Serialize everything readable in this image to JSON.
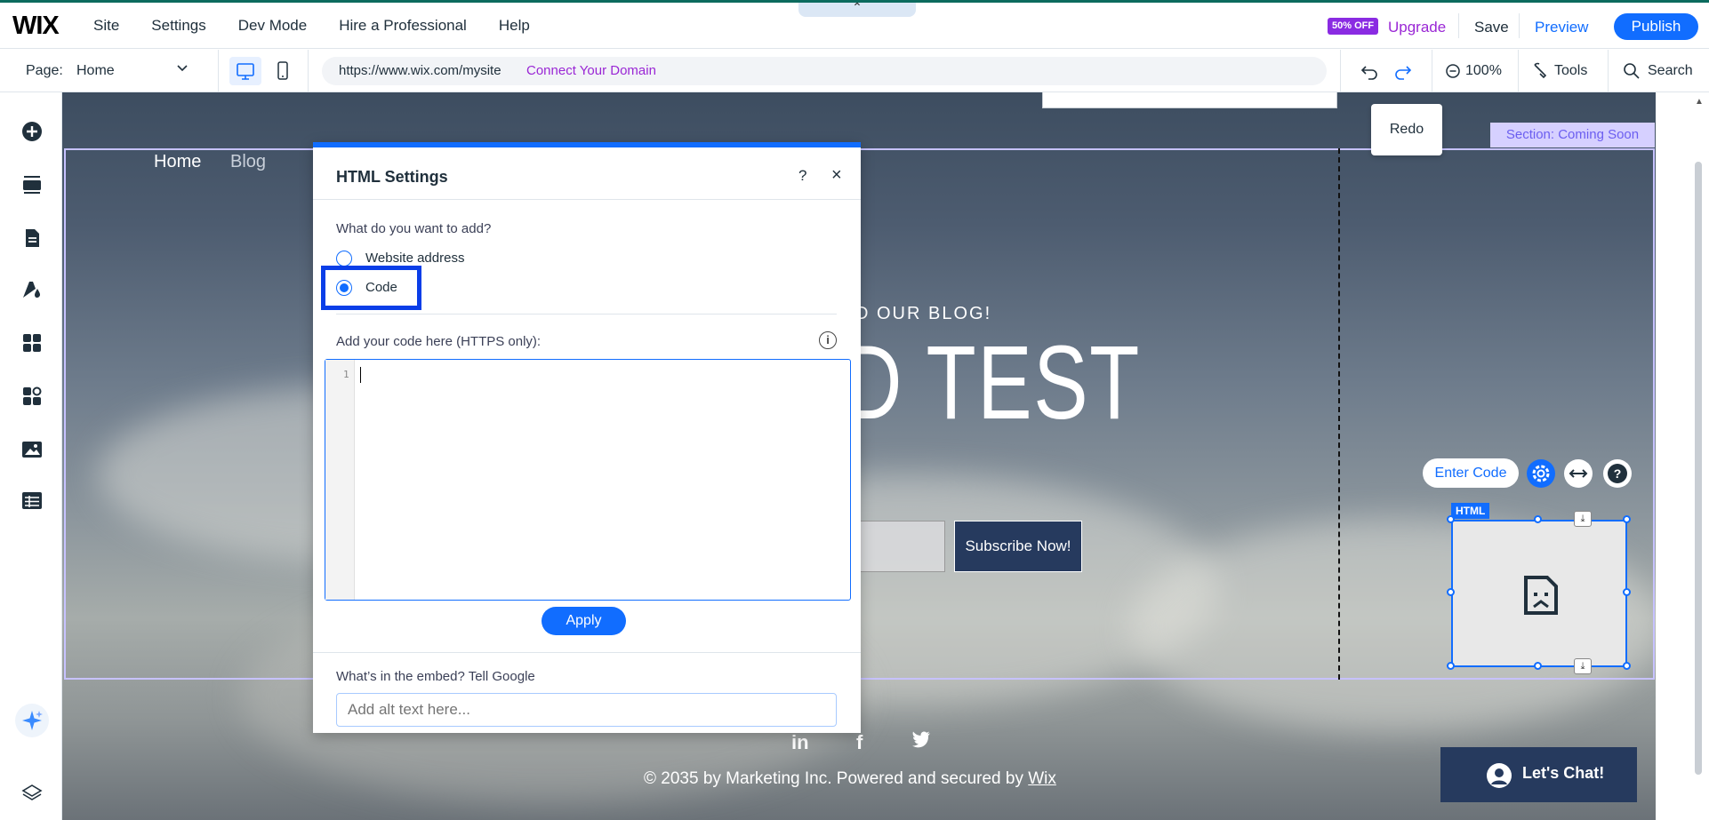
{
  "topbar": {
    "logo": "WIX",
    "menu": [
      "Site",
      "Settings",
      "Dev Mode",
      "Hire a Professional",
      "Help"
    ],
    "handle_icon": "chevron-up-icon",
    "discount_badge": "50% OFF",
    "upgrade": "Upgrade",
    "save": "Save",
    "preview": "Preview",
    "publish": "Publish"
  },
  "toolbar": {
    "page_label": "Page:",
    "page_value": "Home",
    "url": "https://www.wix.com/mysite",
    "connect_domain": "Connect Your Domain",
    "zoom": "100%",
    "tools": "Tools",
    "search": "Search",
    "redo_tooltip": "Redo"
  },
  "canvas": {
    "section_badge": "Section: Coming Soon",
    "nav": [
      "Home",
      "Blog"
    ],
    "blog_heading": "D OUR BLOG!",
    "big_heading": "D TEST",
    "subscribe": "Subscribe Now!",
    "copyright_prefix": "© 2035 by Marketing Inc. Powered and secured by ",
    "copyright_link": "Wix",
    "chat": "Let's Chat!",
    "social": [
      "in",
      "f",
      "t"
    ]
  },
  "html_element": {
    "enter_code": "Enter Code",
    "tag": "HTML",
    "help": "?"
  },
  "dialog": {
    "title": "HTML Settings",
    "help": "?",
    "close": "×",
    "question": "What do you want to add?",
    "options": [
      "Website address",
      "Code"
    ],
    "selected_option": "Code",
    "code_label": "Add your code here (HTTPS only):",
    "line_number": "1",
    "apply": "Apply",
    "embed_label": "What’s in the embed? Tell Google",
    "alt_placeholder": "Add alt text here..."
  },
  "colors": {
    "accent": "#116dff",
    "premium": "#9a27d5",
    "highlight": "#0a3ee8",
    "section_border": "#c7c2ff"
  }
}
